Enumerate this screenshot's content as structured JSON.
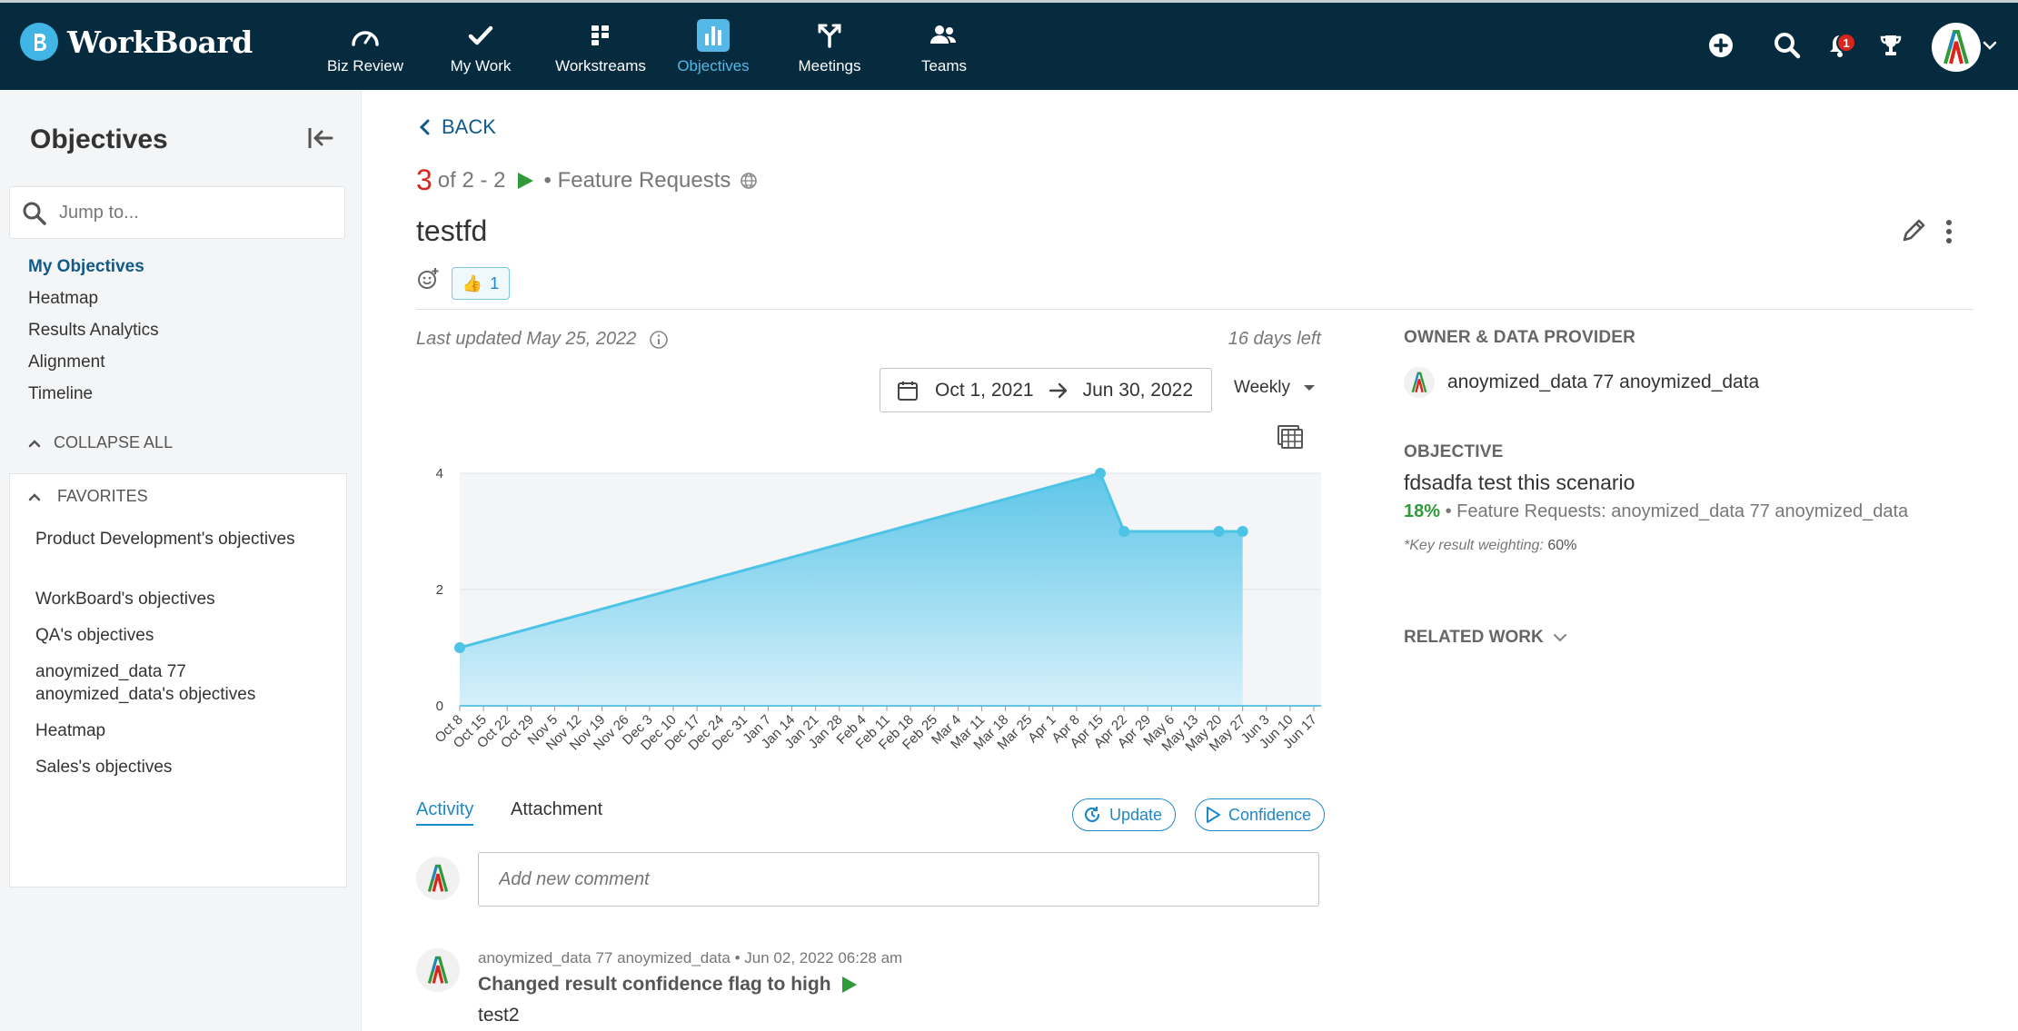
{
  "brand": {
    "name": "WorkBoard"
  },
  "nav": {
    "items": [
      {
        "label": "Biz Review",
        "icon": "gauge-icon"
      },
      {
        "label": "My Work",
        "icon": "check-icon"
      },
      {
        "label": "Workstreams",
        "icon": "grid-icon"
      },
      {
        "label": "Objectives",
        "icon": "bar-chart-icon",
        "active": true
      },
      {
        "label": "Meetings",
        "icon": "split-arrow-icon"
      },
      {
        "label": "Teams",
        "icon": "people-icon"
      }
    ],
    "notification_count": "1"
  },
  "sidebar": {
    "title": "Objectives",
    "search_placeholder": "Jump to...",
    "links": [
      "My Objectives",
      "Heatmap",
      "Results Analytics",
      "Alignment",
      "Timeline"
    ],
    "collapse_all": "COLLAPSE ALL",
    "favorites": {
      "heading": "FAVORITES",
      "items": [
        "Product Development's objectives",
        "WorkBoard's objectives",
        "QA's objectives",
        "anoymized_data 77 anoymized_data's objectives",
        "Heatmap",
        "Sales's objectives"
      ]
    }
  },
  "main": {
    "back_label": "BACK",
    "crumb": {
      "number": "3",
      "text": "of 2 - 2",
      "category": "Feature Requests"
    },
    "title": "testfd",
    "reaction_count": "1",
    "last_updated": "Last updated May 25, 2022",
    "days_left": "16 days left",
    "date_from": "Oct 1, 2021",
    "date_to": "Jun 30, 2022",
    "interval": "Weekly",
    "tabs": [
      "Activity",
      "Attachment"
    ],
    "update_button": "Update",
    "confidence_button": "Confidence",
    "comment_placeholder": "Add new comment",
    "activity": {
      "author": "anoymized_data 77 anoymized_data",
      "timestamp": "Jun 02, 2022 06:28 am",
      "title": "Changed result confidence flag to high",
      "body": "test2"
    }
  },
  "right_panel": {
    "owner_label": "OWNER & DATA PROVIDER",
    "owner_name": "anoymized_data 77 anoymized_data",
    "objective_label": "OBJECTIVE",
    "objective_name": "fdsadfa test this scenario",
    "objective_percent": "18%",
    "objective_sub": "Feature Requests: anoymized_data 77 anoymized_data",
    "weighting_label": "*Key result weighting:",
    "weighting_value": "60%",
    "related_work": "RELATED WORK"
  },
  "chart_data": {
    "type": "area",
    "x_ticks": [
      "Oct 8",
      "Oct 15",
      "Oct 22",
      "Oct 29",
      "Nov 5",
      "Nov 12",
      "Nov 19",
      "Nov 26",
      "Dec 3",
      "Dec 10",
      "Dec 17",
      "Dec 24",
      "Dec 31",
      "Jan 7",
      "Jan 14",
      "Jan 21",
      "Jan 28",
      "Feb 4",
      "Feb 11",
      "Feb 18",
      "Feb 25",
      "Mar 4",
      "Mar 11",
      "Mar 18",
      "Mar 25",
      "Apr 1",
      "Apr 8",
      "Apr 15",
      "Apr 22",
      "Apr 29",
      "May 6",
      "May 13",
      "May 20",
      "May 27",
      "Jun 3",
      "Jun 10",
      "Jun 17"
    ],
    "y_ticks": [
      0,
      2,
      4
    ],
    "ylim": [
      0,
      4
    ],
    "points": [
      {
        "x": "Oct 8",
        "y": 1
      },
      {
        "x": "Apr 15",
        "y": 4
      },
      {
        "x": "Apr 22",
        "y": 3
      },
      {
        "x": "May 20",
        "y": 3
      },
      {
        "x": "May 27",
        "y": 3
      }
    ],
    "color": "#4dc3e6"
  }
}
